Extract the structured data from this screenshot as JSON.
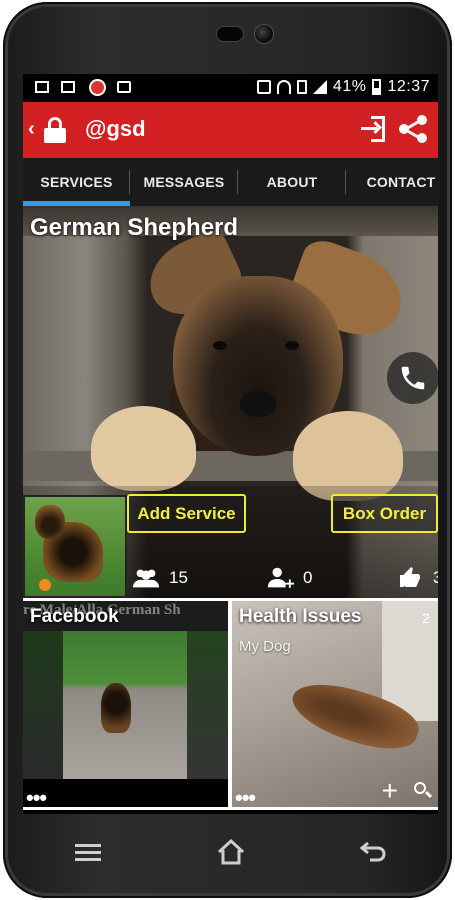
{
  "status_bar": {
    "battery_percent": "41%",
    "time": "12:37"
  },
  "app_bar": {
    "title": "@gsd",
    "color": "#d32022"
  },
  "tabs": [
    {
      "label": "SERVICES",
      "active": true
    },
    {
      "label": "MESSAGES",
      "active": false
    },
    {
      "label": "ABOUT",
      "active": false
    },
    {
      "label": "CONTACT",
      "active": false
    }
  ],
  "hero": {
    "title": "German Shepherd",
    "add_service_label": "Add Service",
    "box_order_label": "Box Order",
    "members_count": "15",
    "followers_count": "0",
    "likes_count": "3"
  },
  "cards": {
    "facebook": {
      "title": "Facebook",
      "overlay_text": "re Male/Alla  German Sh"
    },
    "health": {
      "title": "Health Issues",
      "subtitle": "My Dog",
      "count": "2"
    }
  },
  "colors": {
    "accent": "#2b9fe0",
    "button_outline": "#f0ea3a"
  }
}
